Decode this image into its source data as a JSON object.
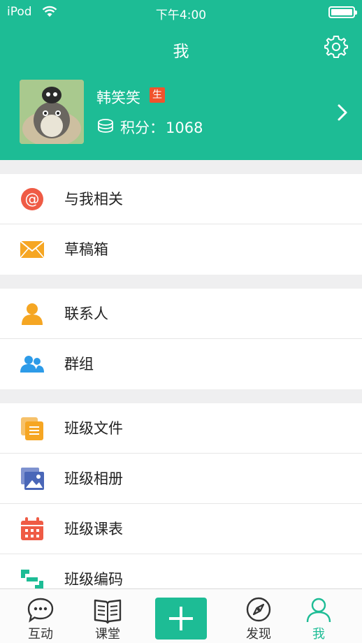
{
  "status_bar": {
    "carrier": "iPod",
    "time": "下午4:00"
  },
  "header": {
    "title": "我"
  },
  "profile": {
    "name": "韩笑笑",
    "role_badge": "生",
    "points_label": "积分：",
    "points_value": "1068"
  },
  "groups": [
    {
      "items": [
        {
          "label": "与我相关",
          "icon": "at-icon",
          "color": "#ef5b45"
        },
        {
          "label": "草稿箱",
          "icon": "envelope-icon",
          "color": "#f6a623"
        }
      ]
    },
    {
      "items": [
        {
          "label": "联系人",
          "icon": "person-icon",
          "color": "#f5a623"
        },
        {
          "label": "群组",
          "icon": "group-icon",
          "color": "#2d9be8"
        }
      ]
    },
    {
      "items": [
        {
          "label": "班级文件",
          "icon": "files-icon",
          "color": "#f6a623"
        },
        {
          "label": "班级相册",
          "icon": "album-icon",
          "color": "#4a67b8"
        },
        {
          "label": "班级课表",
          "icon": "calendar-icon",
          "color": "#ef5b45"
        },
        {
          "label": "班级编码",
          "icon": "scan-code-icon",
          "color": "#1dbc95"
        }
      ]
    }
  ],
  "tabs": {
    "interact": "互动",
    "classroom": "课堂",
    "discover": "发现",
    "me": "我"
  },
  "colors": {
    "primary": "#1dbc95",
    "badge": "#f0532c"
  }
}
